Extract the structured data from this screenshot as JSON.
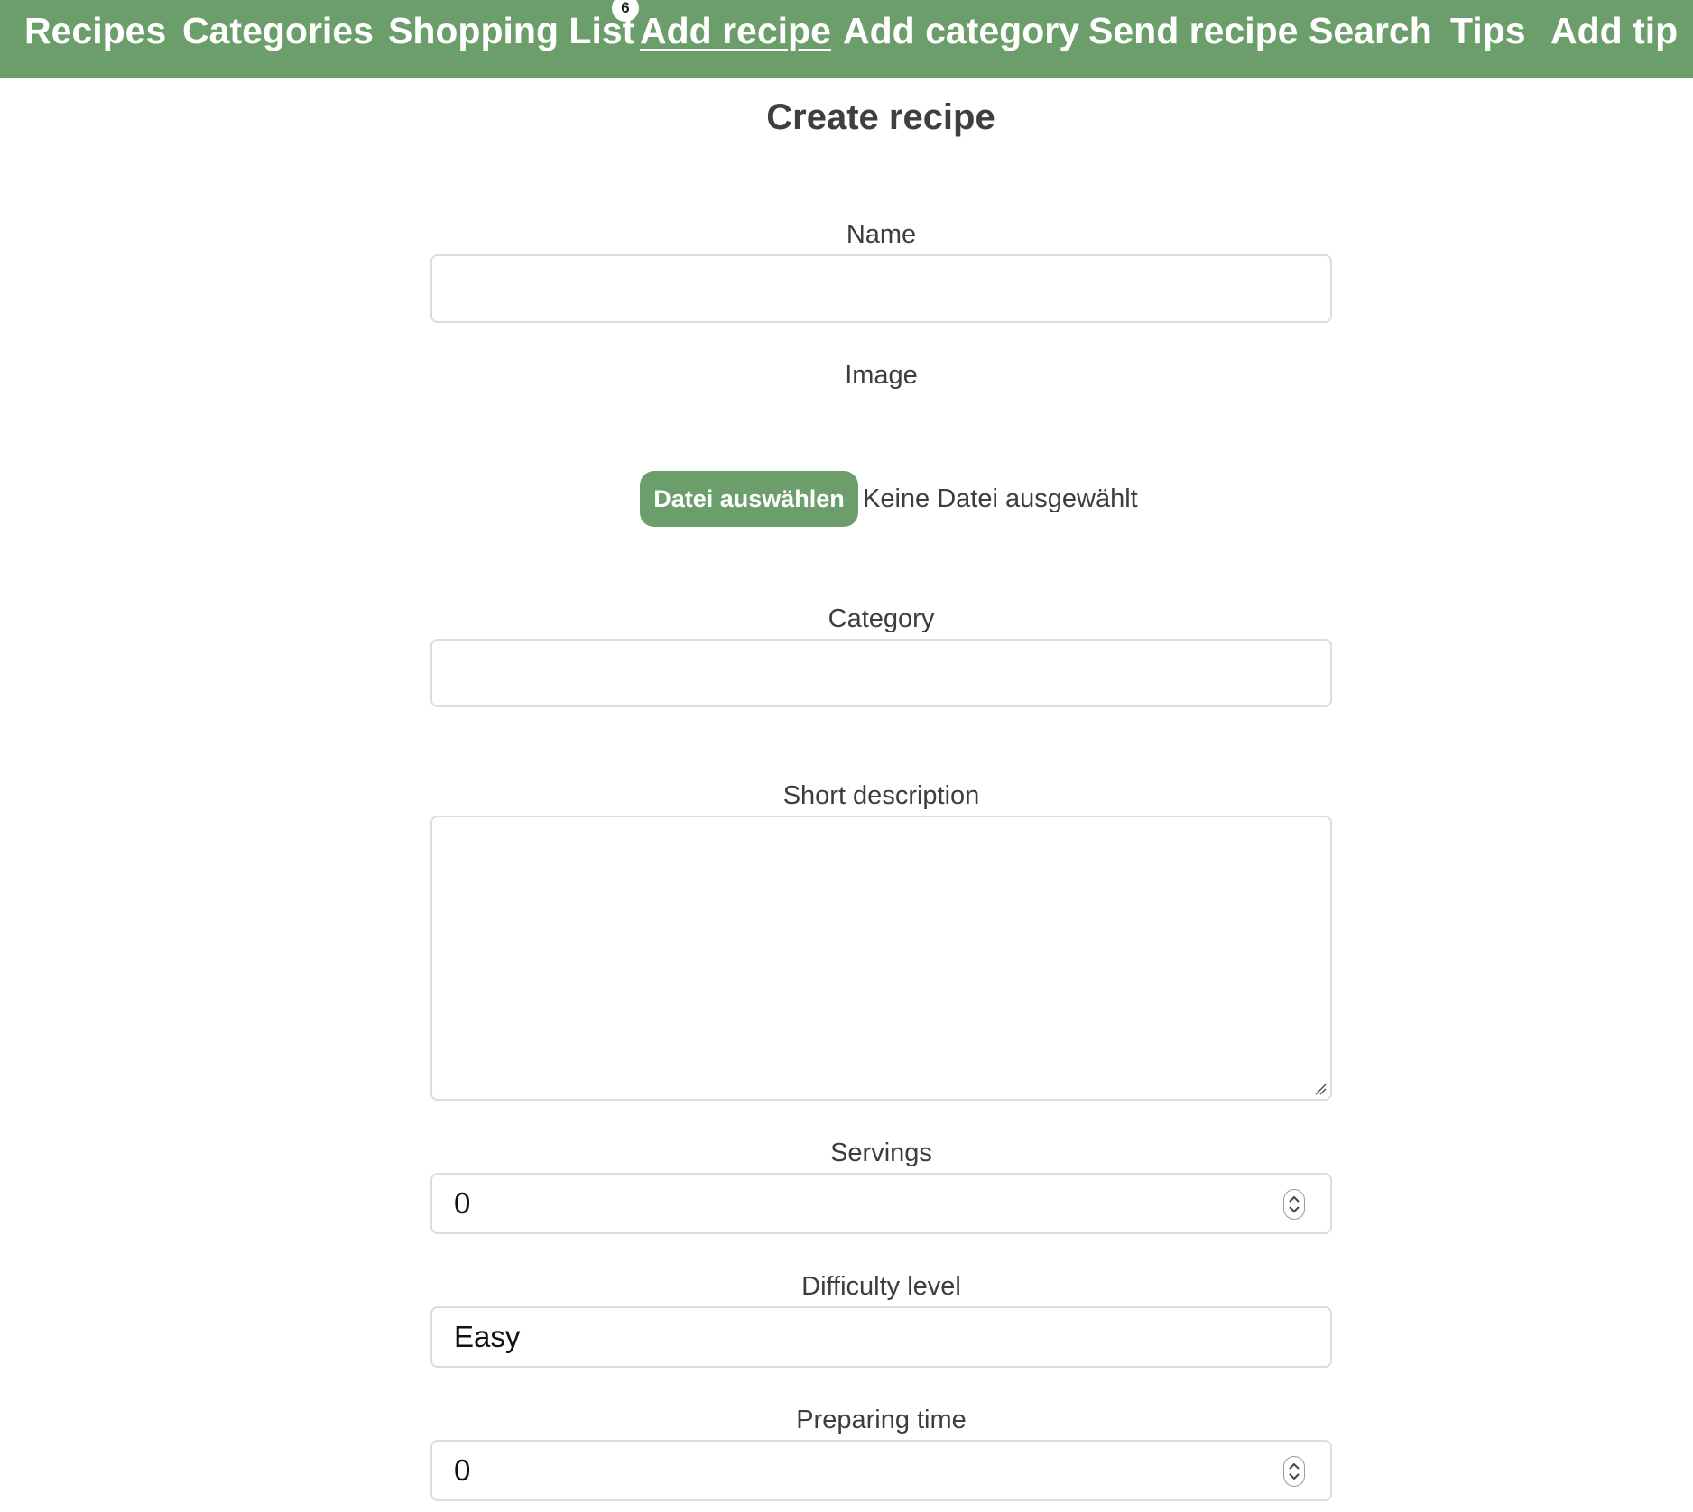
{
  "nav": {
    "items": [
      {
        "label": "Recipes"
      },
      {
        "label": "Categories"
      },
      {
        "label": "Shopping List"
      },
      {
        "label": "Add recipe"
      },
      {
        "label": "Add category"
      },
      {
        "label": "Send recipe"
      },
      {
        "label": "Search"
      },
      {
        "label": "Tips"
      },
      {
        "label": "Add tip"
      }
    ],
    "active": "Add recipe",
    "shopping_badge": "6"
  },
  "form": {
    "title": "Create recipe",
    "name": {
      "label": "Name",
      "value": ""
    },
    "image": {
      "label": "Image",
      "button_label": "Datei auswählen",
      "status": "Keine Datei ausgewählt"
    },
    "category": {
      "label": "Category",
      "value": ""
    },
    "short_description": {
      "label": "Short description",
      "value": ""
    },
    "servings": {
      "label": "Servings",
      "value": "0"
    },
    "difficulty": {
      "label": "Difficulty level",
      "value": "Easy"
    },
    "preparing_time": {
      "label": "Preparing time",
      "value": "0"
    }
  },
  "colors": {
    "accent": "#6b9e6b",
    "text": "#3d3d3d",
    "border": "#dcdcdc"
  },
  "icons": {
    "spinner": "up-down-arrows-icon",
    "resize": "resize-grip-icon"
  }
}
